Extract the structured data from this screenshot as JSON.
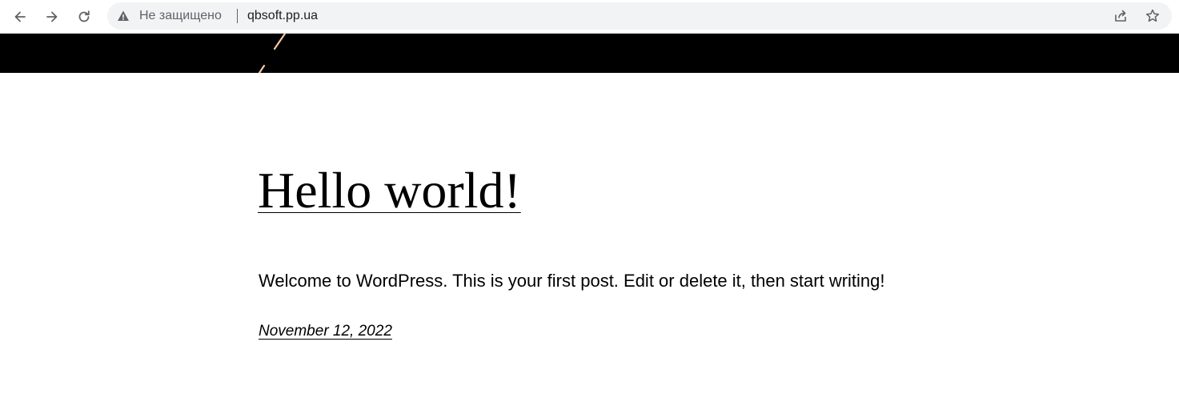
{
  "browser": {
    "security_label": "Не защищено",
    "url": "qbsoft.pp.ua",
    "icons": {
      "back": "arrow-left-icon",
      "forward": "arrow-right-icon",
      "reload": "reload-icon",
      "security": "warning-triangle-icon",
      "share": "share-icon",
      "bookmark": "star-icon"
    }
  },
  "site_header": {
    "background_color": "#000000",
    "accent_color": "#f4c9a8"
  },
  "post": {
    "title": "Hello world!",
    "excerpt": "Welcome to WordPress. This is your first post. Edit or delete it, then start writing!",
    "date": "November 12, 2022"
  }
}
